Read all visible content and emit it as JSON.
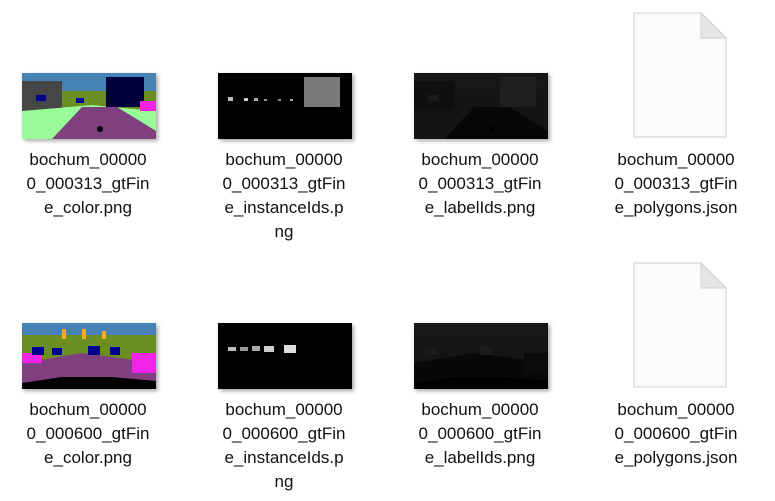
{
  "files": [
    {
      "kind": "color",
      "name_lines": [
        "bochum_00000",
        "0_000313_gtFin",
        "e_color.png"
      ]
    },
    {
      "kind": "instance",
      "name_lines": [
        "bochum_00000",
        "0_000313_gtFin",
        "e_instanceIds.p",
        "ng"
      ]
    },
    {
      "kind": "label",
      "name_lines": [
        "bochum_00000",
        "0_000313_gtFin",
        "e_labelIds.png"
      ]
    },
    {
      "kind": "json",
      "name_lines": [
        "bochum_00000",
        "0_000313_gtFin",
        "e_polygons.json"
      ]
    },
    {
      "kind": "color",
      "name_lines": [
        "bochum_00000",
        "0_000600_gtFin",
        "e_color.png"
      ]
    },
    {
      "kind": "instance",
      "name_lines": [
        "bochum_00000",
        "0_000600_gtFin",
        "e_instanceIds.p",
        "ng"
      ]
    },
    {
      "kind": "label",
      "name_lines": [
        "bochum_00000",
        "0_000600_gtFin",
        "e_labelIds.png"
      ]
    },
    {
      "kind": "json",
      "name_lines": [
        "bochum_00000",
        "0_000600_gtFin",
        "e_polygons.json"
      ]
    }
  ],
  "colors": {
    "road": "#804080",
    "sidewalk": "#f423e8",
    "vegetation": "#6b8e23",
    "terrain": "#98fb98",
    "building": "#464646",
    "truck": "#00003c",
    "car": "#00008e",
    "sky": "#4682b4",
    "selection_none": "#ffffff"
  },
  "icons": {
    "image_thumbnail": "image-thumbnail-icon",
    "json_file": "blank-document-icon"
  }
}
